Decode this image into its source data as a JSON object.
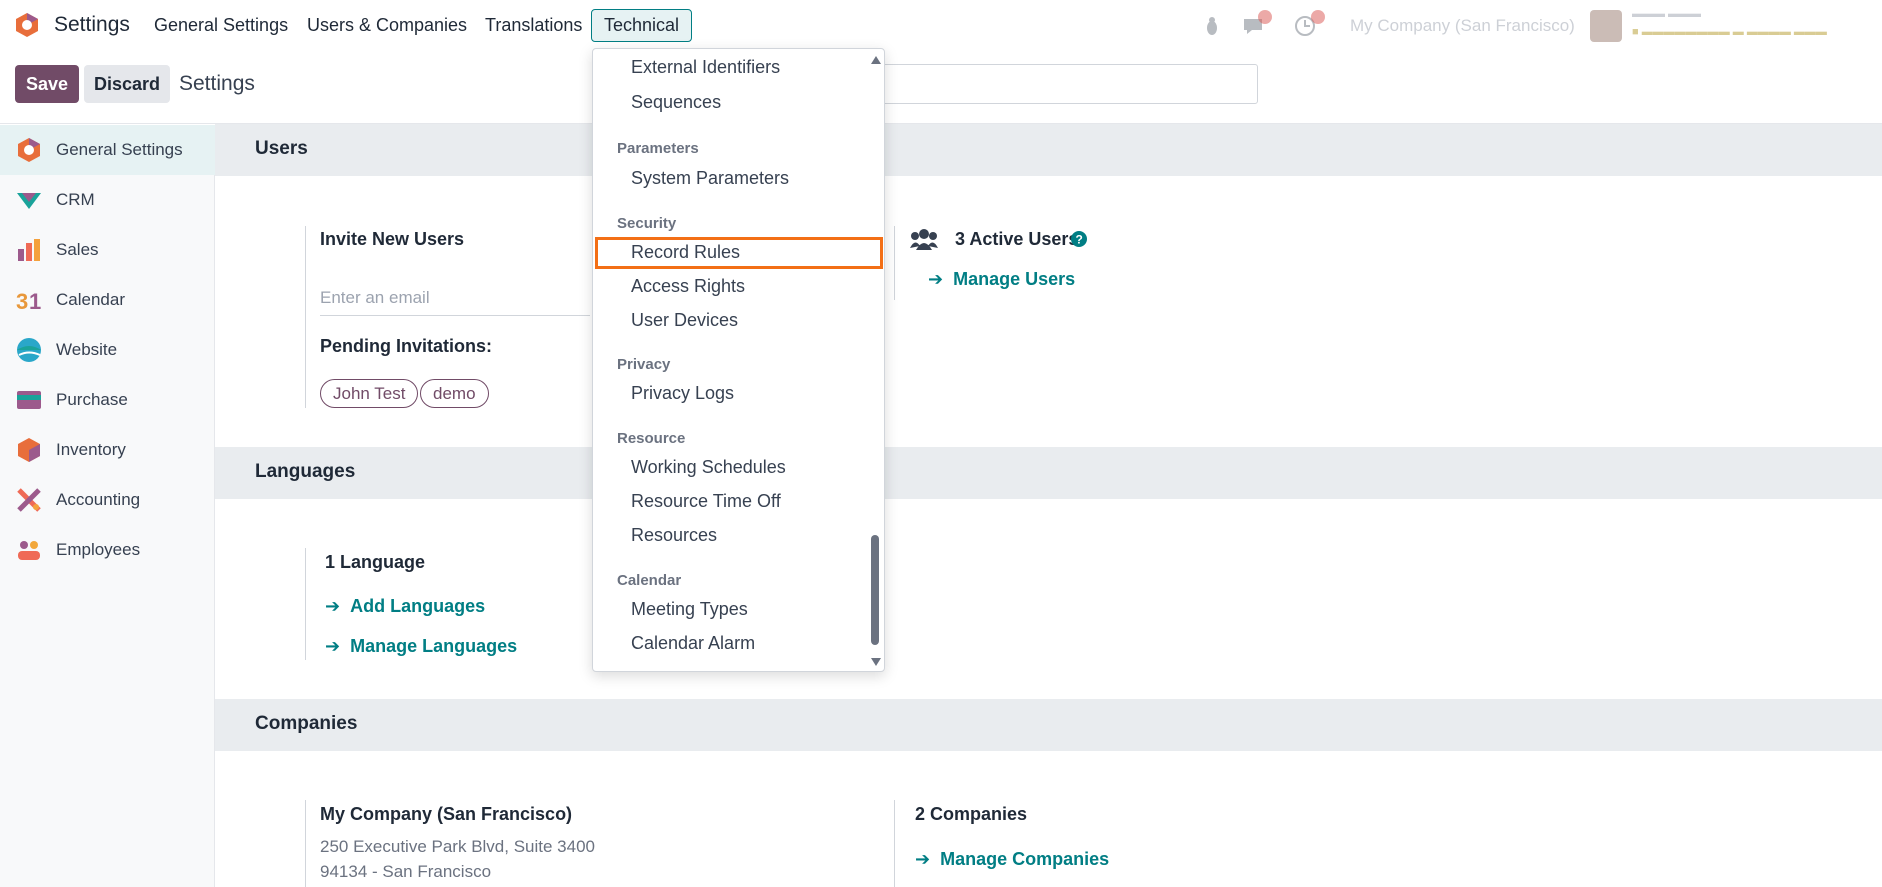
{
  "navbar": {
    "app_name": "Settings",
    "menus": [
      "General Settings",
      "Users & Companies",
      "Translations",
      "Technical"
    ],
    "company": "My Company (San Francisco)"
  },
  "control_panel": {
    "save_label": "Save",
    "discard_label": "Discard",
    "title": "Settings"
  },
  "sidebar": {
    "items": [
      {
        "label": "General Settings",
        "icon": "settings-hex-icon",
        "color": "#e86e3b"
      },
      {
        "label": "CRM",
        "icon": "crm-icon",
        "color": "#1aa39a"
      },
      {
        "label": "Sales",
        "icon": "sales-icon",
        "color": "#f4a13c"
      },
      {
        "label": "Calendar",
        "icon": "calendar-icon",
        "color": "#e8983b"
      },
      {
        "label": "Website",
        "icon": "website-icon",
        "color": "#2aa7c9"
      },
      {
        "label": "Purchase",
        "icon": "purchase-icon",
        "color": "#9c5a8c"
      },
      {
        "label": "Inventory",
        "icon": "inventory-icon",
        "color": "#e86e3b"
      },
      {
        "label": "Accounting",
        "icon": "accounting-icon",
        "color": "#ef6a56"
      },
      {
        "label": "Employees",
        "icon": "employees-icon",
        "color": "#f2a83b"
      }
    ]
  },
  "users": {
    "header": "Users",
    "invite_title": "Invite New Users",
    "email_placeholder": "Enter an email",
    "pending_title": "Pending Invitations:",
    "pending": [
      "John Test",
      "demo"
    ],
    "active_users": "3 Active Users",
    "manage_users": "Manage Users"
  },
  "languages": {
    "header": "Languages",
    "count": "1 Language",
    "add": "Add Languages",
    "manage": "Manage Languages"
  },
  "companies": {
    "header": "Companies",
    "name": "My Company (San Francisco)",
    "address1": "250 Executive Park Blvd, Suite 3400",
    "address2": "94134 - San Francisco",
    "count": "2 Companies",
    "manage": "Manage Companies"
  },
  "dropdown": {
    "top_items": [
      "External Identifiers",
      "Sequences"
    ],
    "groups": [
      {
        "header": "Parameters",
        "items": [
          "System Parameters"
        ]
      },
      {
        "header": "Security",
        "items": [
          "Record Rules",
          "Access Rights",
          "User Devices"
        ]
      },
      {
        "header": "Privacy",
        "items": [
          "Privacy Logs"
        ]
      },
      {
        "header": "Resource",
        "items": [
          "Working Schedules",
          "Resource Time Off",
          "Resources"
        ]
      },
      {
        "header": "Calendar",
        "items": [
          "Meeting Types",
          "Calendar Alarm"
        ]
      }
    ]
  },
  "colors": {
    "brand": "#714b67",
    "accent": "#017e84",
    "highlight": "#f36f16"
  }
}
